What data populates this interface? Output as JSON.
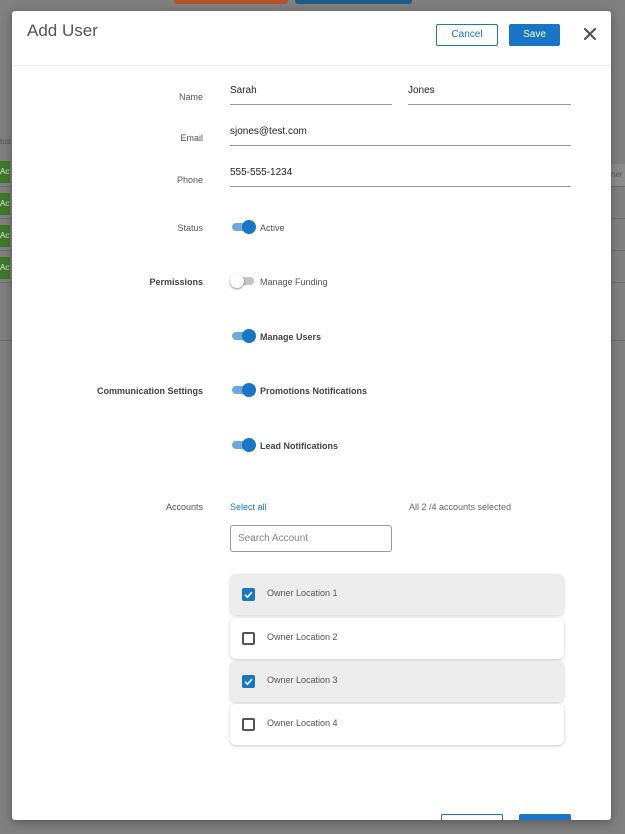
{
  "modal": {
    "title": "Add User",
    "cancel_label": "Cancel",
    "save_label": "Save"
  },
  "form": {
    "name_label": "Name",
    "first_name": "Sarah",
    "last_name": "Jones",
    "email_label": "Email",
    "email": "sjones@test.com",
    "phone_label": "Phone",
    "phone": "555-555-1234",
    "status_label": "Status",
    "status_value": "Active",
    "status_on": true,
    "permissions_label": "Permissions",
    "permissions": [
      {
        "label": "Manage Funding",
        "on": false
      },
      {
        "label": "Manage Users",
        "on": true
      }
    ],
    "communication_label": "Communication Settings",
    "communication": [
      {
        "label": "Promotions Notifications",
        "on": true
      },
      {
        "label": "Lead Notifications",
        "on": true
      }
    ]
  },
  "accounts": {
    "label": "Accounts",
    "select_all": "Select all",
    "count_text": "All 2 /4 accounts selected",
    "search_placeholder": "Search Account",
    "items": [
      {
        "name": "Owner Location 1",
        "checked": true
      },
      {
        "name": "Owner Location 2",
        "checked": false
      },
      {
        "name": "Owner Location 3",
        "checked": true
      },
      {
        "name": "Owner Location 4",
        "checked": false
      }
    ]
  },
  "background": {
    "tag_text": "Acti",
    "column_text": "ner",
    "status_text": "tus"
  },
  "colors": {
    "accent": "#1976c6",
    "overlay": "#808080"
  }
}
